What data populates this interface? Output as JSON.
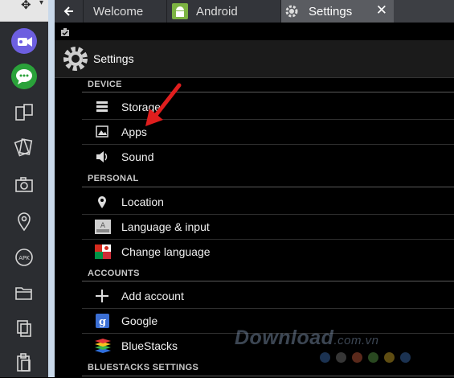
{
  "tabs": [
    {
      "label": "Welcome",
      "icon": "back-arrow-icon"
    },
    {
      "label": "Android",
      "icon": "android-icon"
    },
    {
      "label": "Settings",
      "icon": "gear-icon"
    }
  ],
  "action_bar": {
    "title": "Settings"
  },
  "sections": {
    "device": "DEVICE",
    "personal": "PERSONAL",
    "accounts": "ACCOUNTS",
    "bluestacks": "BLUESTACKS SETTINGS"
  },
  "items": {
    "storage": "Storage",
    "apps": "Apps",
    "sound": "Sound",
    "location": "Location",
    "language_input": "Language & input",
    "change_language": "Change language",
    "add_account": "Add account",
    "google": "Google",
    "bluestacks": "BlueStacks"
  },
  "watermark": {
    "brand": "Download",
    "suffix": ".com.vn"
  },
  "colors": {
    "accent_purple": "#6d5fe0",
    "accent_green": "#2aa23a",
    "annotation_arrow": "#e01e1e",
    "google_blue": "#3b6fd4"
  }
}
